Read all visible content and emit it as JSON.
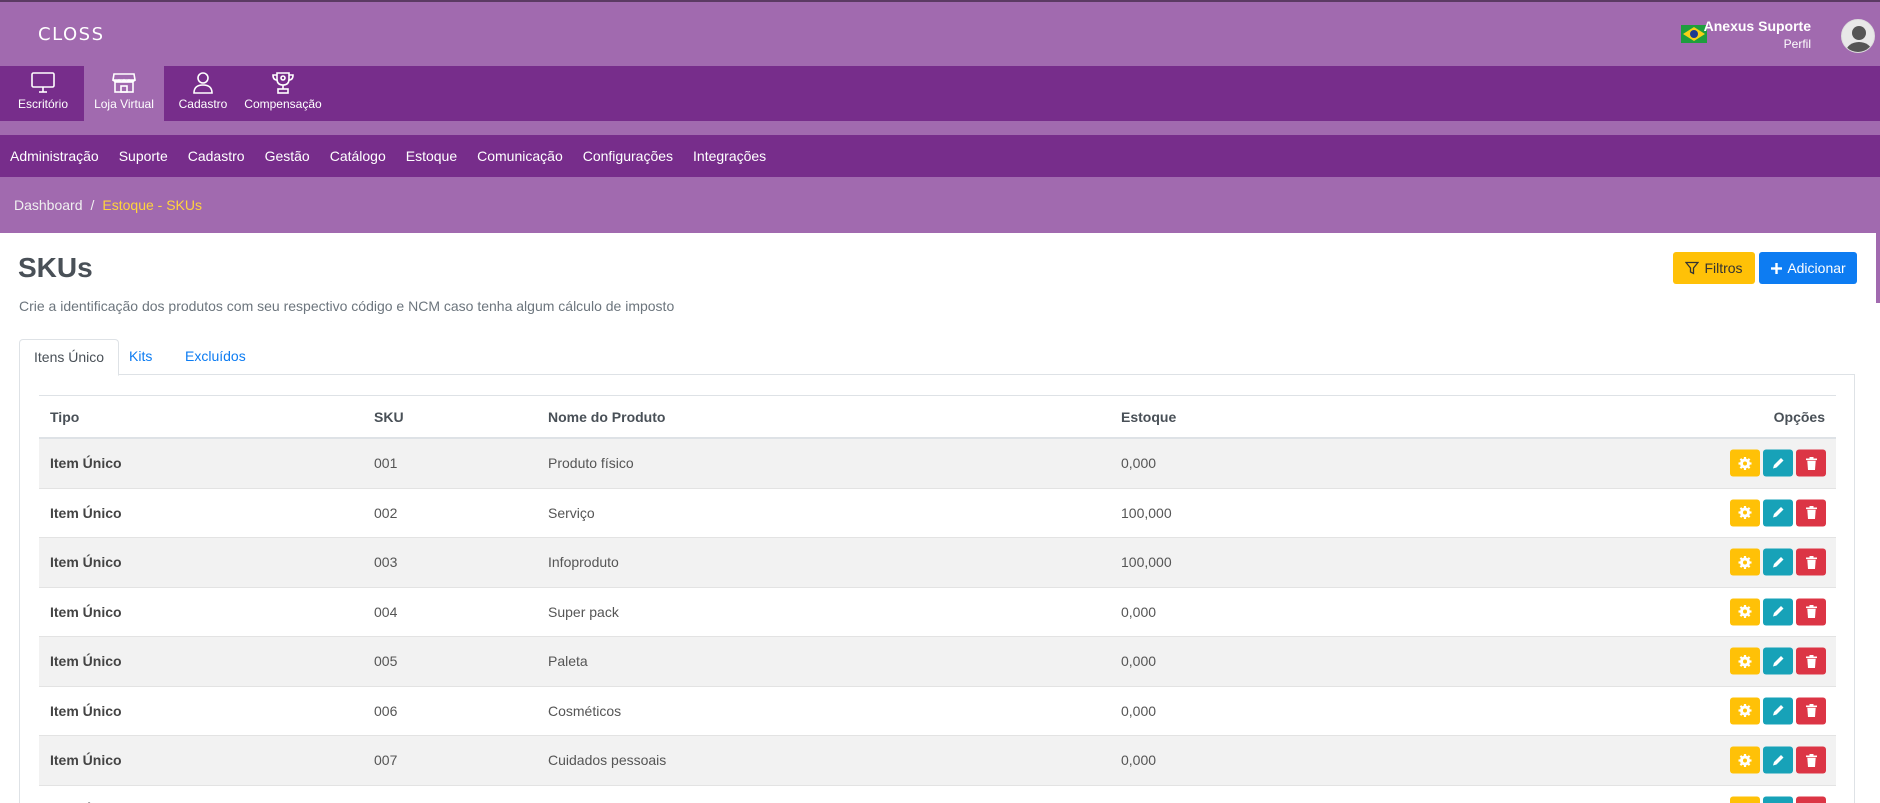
{
  "app": {
    "logo_text": "CLOSS",
    "user_name": "Anexus Suporte",
    "user_link": "Perfil",
    "language_flag_icon": "brazil-flag-icon"
  },
  "modules": [
    {
      "label": "Escritório",
      "icon": "desktop-monitor-icon",
      "active": false
    },
    {
      "label": "Loja Virtual",
      "icon": "storefront-icon",
      "active": true
    },
    {
      "label": "Cadastro",
      "icon": "user-icon",
      "active": false
    },
    {
      "label": "Compensação",
      "icon": "trophy-icon",
      "active": false
    }
  ],
  "menu": [
    "Administração",
    "Suporte",
    "Cadastro",
    "Gestão",
    "Catálogo",
    "Estoque",
    "Comunicação",
    "Configurações",
    "Integrações"
  ],
  "breadcrumb": {
    "root": "Dashboard",
    "separator": "/",
    "current": "Estoque - SKUs"
  },
  "page": {
    "title": "SKUs",
    "description": "Crie a identificação dos produtos com seu respectivo código e NCM caso tenha algum cálculo de imposto",
    "filter_label": "Filtros",
    "add_label": "Adicionar"
  },
  "tabs": [
    {
      "label": "Itens Único",
      "active": true
    },
    {
      "label": "Kits",
      "active": false
    },
    {
      "label": "Excluídos",
      "active": false
    }
  ],
  "table": {
    "headers": {
      "tipo": "Tipo",
      "sku": "SKU",
      "nome": "Nome do Produto",
      "estoque": "Estoque",
      "opcoes": "Opções"
    },
    "rows": [
      {
        "tipo": "Item Único",
        "sku": "001",
        "nome": "Produto físico",
        "estoque": "0,000"
      },
      {
        "tipo": "Item Único",
        "sku": "002",
        "nome": "Serviço",
        "estoque": "100,000"
      },
      {
        "tipo": "Item Único",
        "sku": "003",
        "nome": "Infoproduto",
        "estoque": "100,000"
      },
      {
        "tipo": "Item Único",
        "sku": "004",
        "nome": "Super pack",
        "estoque": "0,000"
      },
      {
        "tipo": "Item Único",
        "sku": "005",
        "nome": "Paleta",
        "estoque": "0,000"
      },
      {
        "tipo": "Item Único",
        "sku": "006",
        "nome": "Cosméticos",
        "estoque": "0,000"
      },
      {
        "tipo": "Item Único",
        "sku": "007",
        "nome": "Cuidados pessoais",
        "estoque": "0,000"
      },
      {
        "tipo": "Item Único",
        "sku": "",
        "nome": "",
        "estoque": ""
      }
    ]
  },
  "colors": {
    "header_light": "#a16aaf",
    "header_dark": "#772d8b",
    "accent_yellow": "#ffc107",
    "accent_blue": "#0d7cf2",
    "action_teal": "#17a2b8",
    "action_red": "#dc3545",
    "breadcrumb_active": "#ffd43b"
  }
}
